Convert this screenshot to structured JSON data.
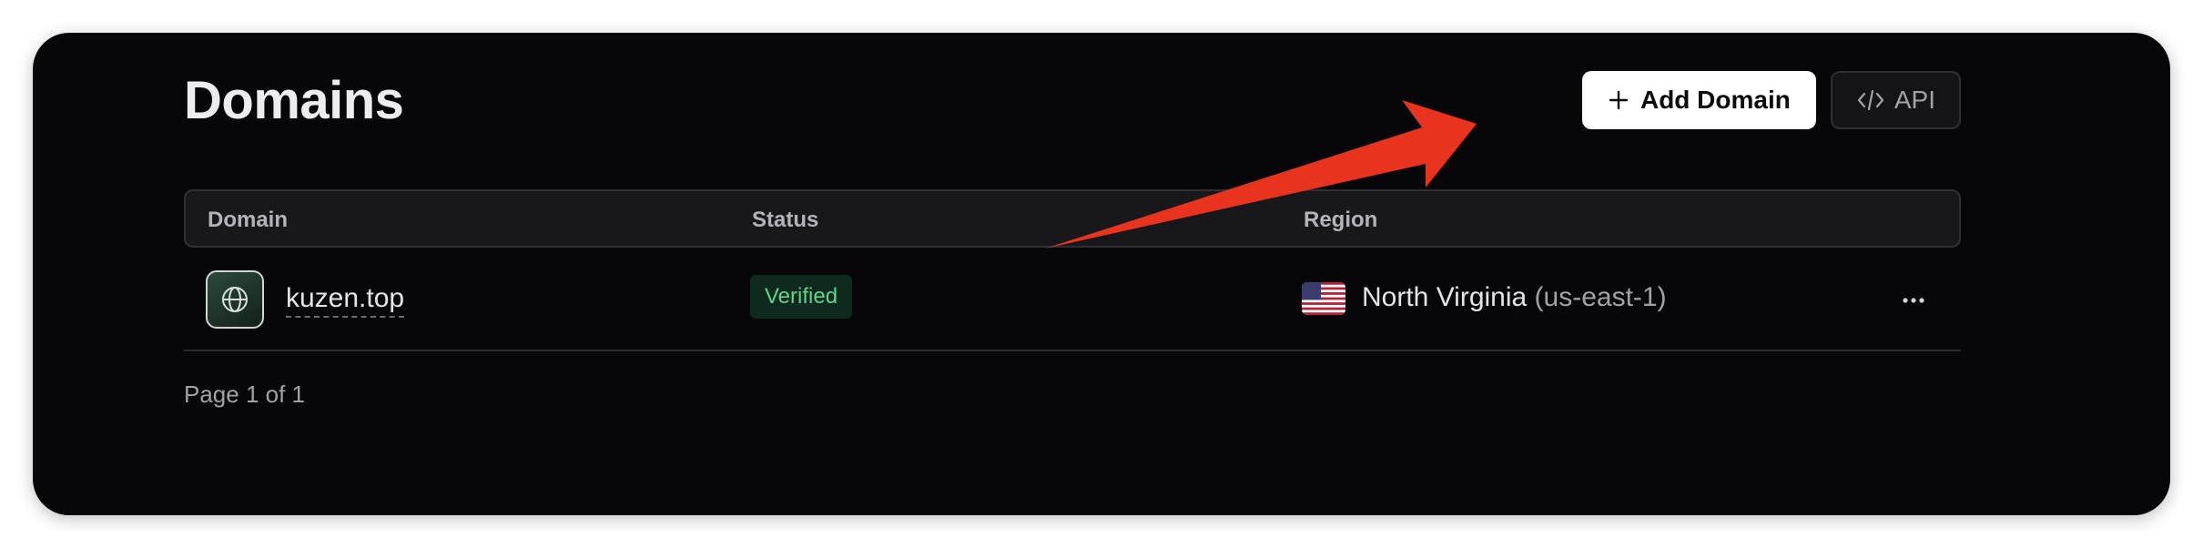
{
  "page": {
    "title": "Domains"
  },
  "actions": {
    "add_domain_label": "Add Domain",
    "api_label": "API"
  },
  "table": {
    "columns": [
      "Domain",
      "Status",
      "Region"
    ],
    "rows": [
      {
        "domain": "kuzen.top",
        "status": "Verified",
        "region_name": "North Virginia",
        "region_code": "(us-east-1)"
      }
    ]
  },
  "pagination": {
    "label": "Page 1 of 1"
  },
  "icons": {
    "domain": "globe-icon",
    "add": "plus-icon",
    "api": "code-icon",
    "region": "us-flag-icon",
    "more": "more-horizontal-icon",
    "annotation": "red-arrow"
  },
  "colors": {
    "background": "#07070a",
    "verified_text": "#5fd38e",
    "verified_bg": "#0e2a1c",
    "annotation_arrow": "#e8341f"
  }
}
